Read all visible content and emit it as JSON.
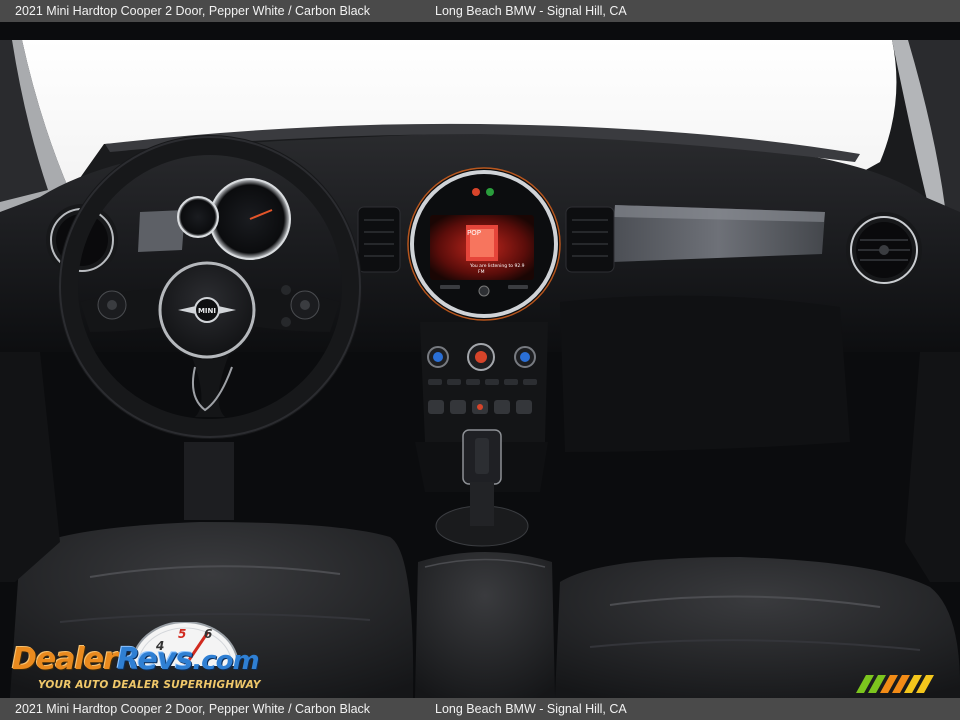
{
  "caption": {
    "vehicle": "2021 Mini Hardtop Cooper 2 Door,  Pepper White / Carbon Black",
    "dealer": "Long Beach BMW - Signal Hill, CA"
  },
  "photo": {
    "subject": "interior-dashboard",
    "infotainment_screen": {
      "badge": "POP",
      "line1": "You are listening to 92.9",
      "line2": "FM"
    },
    "badge_text": "MINI"
  },
  "watermark": {
    "brand_part1": "Dealer",
    "brand_part2": "Revs",
    "brand_part3": ".com",
    "tagline": "YOUR AUTO DEALER SUPERHIGHWAY",
    "gauge_digits": [
      "4",
      "5",
      "6"
    ]
  },
  "colors": {
    "caption_bg": "#4a4a4a",
    "caption_text": "#f2f2f2",
    "watermark_orange": "#e98a1e",
    "watermark_blue": "#2f7fd3",
    "stripe_green": "#7cc51e",
    "stripe_orange": "#f28b16",
    "stripe_yellow": "#f3c61c"
  }
}
